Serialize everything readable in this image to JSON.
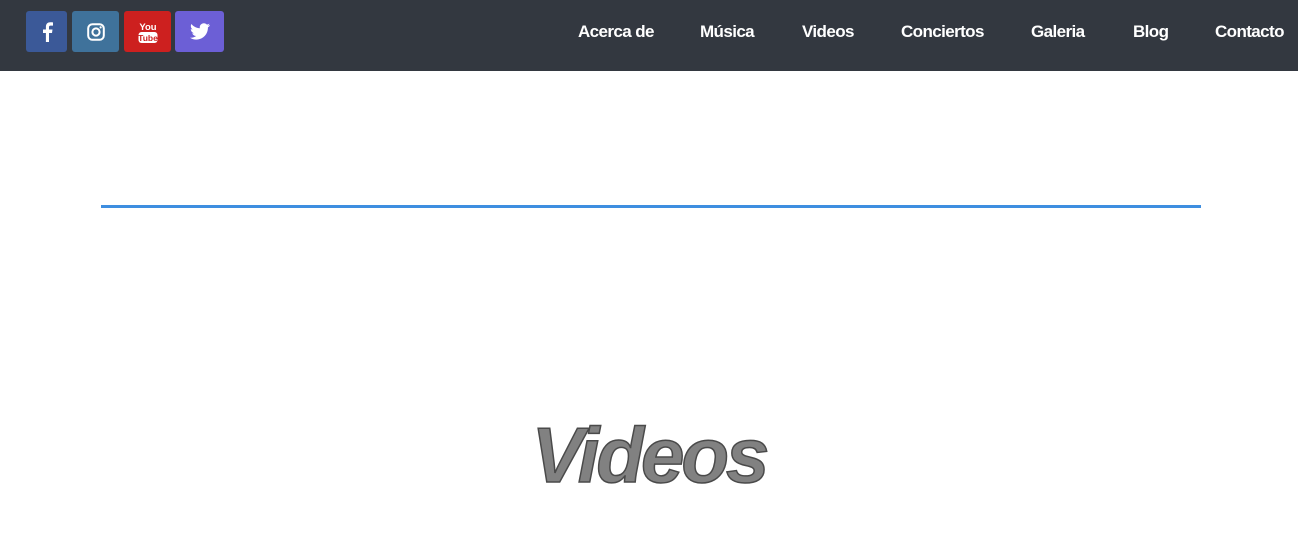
{
  "social": [
    {
      "name": "facebook",
      "icon": "facebook-icon",
      "color": "#3b5998"
    },
    {
      "name": "instagram",
      "icon": "instagram-icon",
      "color": "#3f729b"
    },
    {
      "name": "youtube",
      "icon": "youtube-icon",
      "color": "#cd201f",
      "logo_text_top": "You",
      "logo_text_bottom": "Tube"
    },
    {
      "name": "twitter",
      "icon": "twitter-icon",
      "color": "#6c5fd6"
    }
  ],
  "nav": {
    "items": [
      {
        "label": "Acerca de"
      },
      {
        "label": "Música"
      },
      {
        "label": "Videos"
      },
      {
        "label": "Conciertos"
      },
      {
        "label": "Galeria"
      },
      {
        "label": "Blog"
      },
      {
        "label": "Contacto"
      }
    ]
  },
  "colors": {
    "topbar": "#333840",
    "accent_rule": "#3e8ee0",
    "heading": "#818181"
  },
  "main": {
    "heading": "Videos"
  }
}
